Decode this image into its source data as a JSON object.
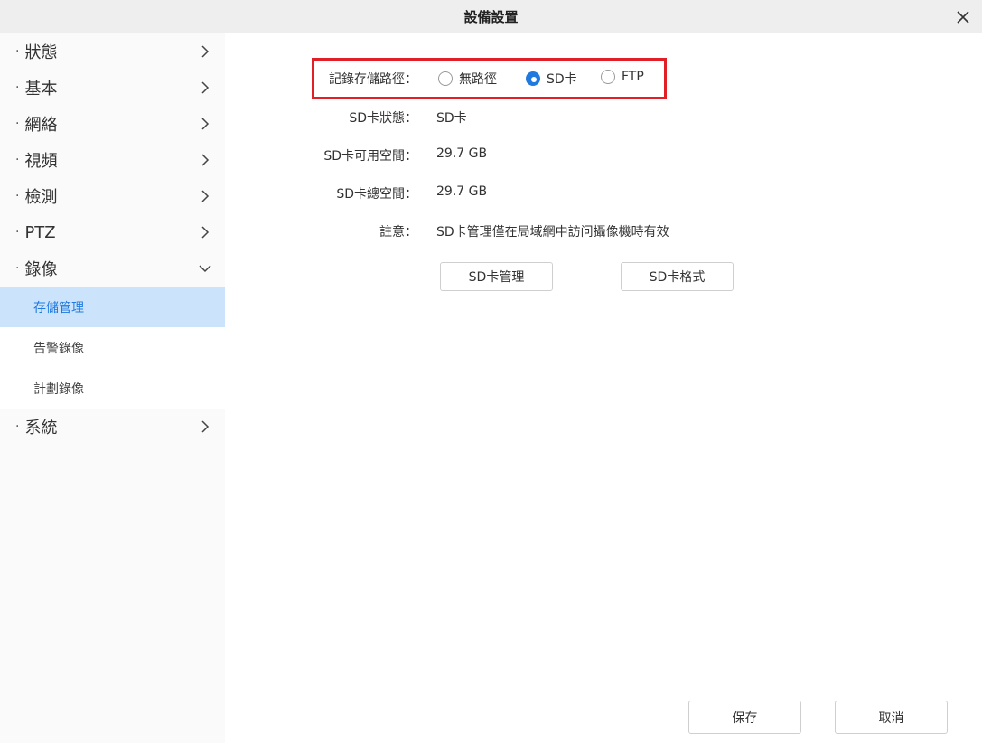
{
  "window": {
    "title": "設備設置"
  },
  "sidebar": {
    "items": [
      {
        "label": "狀態"
      },
      {
        "label": "基本"
      },
      {
        "label": "網絡"
      },
      {
        "label": "視頻"
      },
      {
        "label": "檢測"
      },
      {
        "label": "PTZ"
      },
      {
        "label": "錄像"
      },
      {
        "label": "系統"
      }
    ],
    "subitems": [
      {
        "label": "存儲管理"
      },
      {
        "label": "告警錄像"
      },
      {
        "label": "計劃錄像"
      }
    ],
    "bullet": "·"
  },
  "storage": {
    "path_label": "記錄存儲路徑：",
    "options": [
      {
        "label": "無路徑",
        "checked": false
      },
      {
        "label": "SD卡",
        "checked": true
      },
      {
        "label": "FTP",
        "checked": false
      }
    ],
    "sd_status_label": "SD卡狀態：",
    "sd_status_value": "SD卡",
    "sd_free_label": "SD卡可用空間：",
    "sd_free_value": "29.7 GB",
    "sd_total_label": "SD卡總空間：",
    "sd_total_value": "29.7 GB",
    "note_label": "註意：",
    "note_value": "SD卡管理僅在局域網中訪问攝像機時有效",
    "manage_button": "SD卡管理",
    "format_button": "SD卡格式"
  },
  "footer": {
    "save_button": "保存",
    "cancel_button": "取消"
  },
  "colors": {
    "accent": "#1f7ae0",
    "highlight_border": "#e21e26",
    "active_bg": "#cce4fb"
  }
}
